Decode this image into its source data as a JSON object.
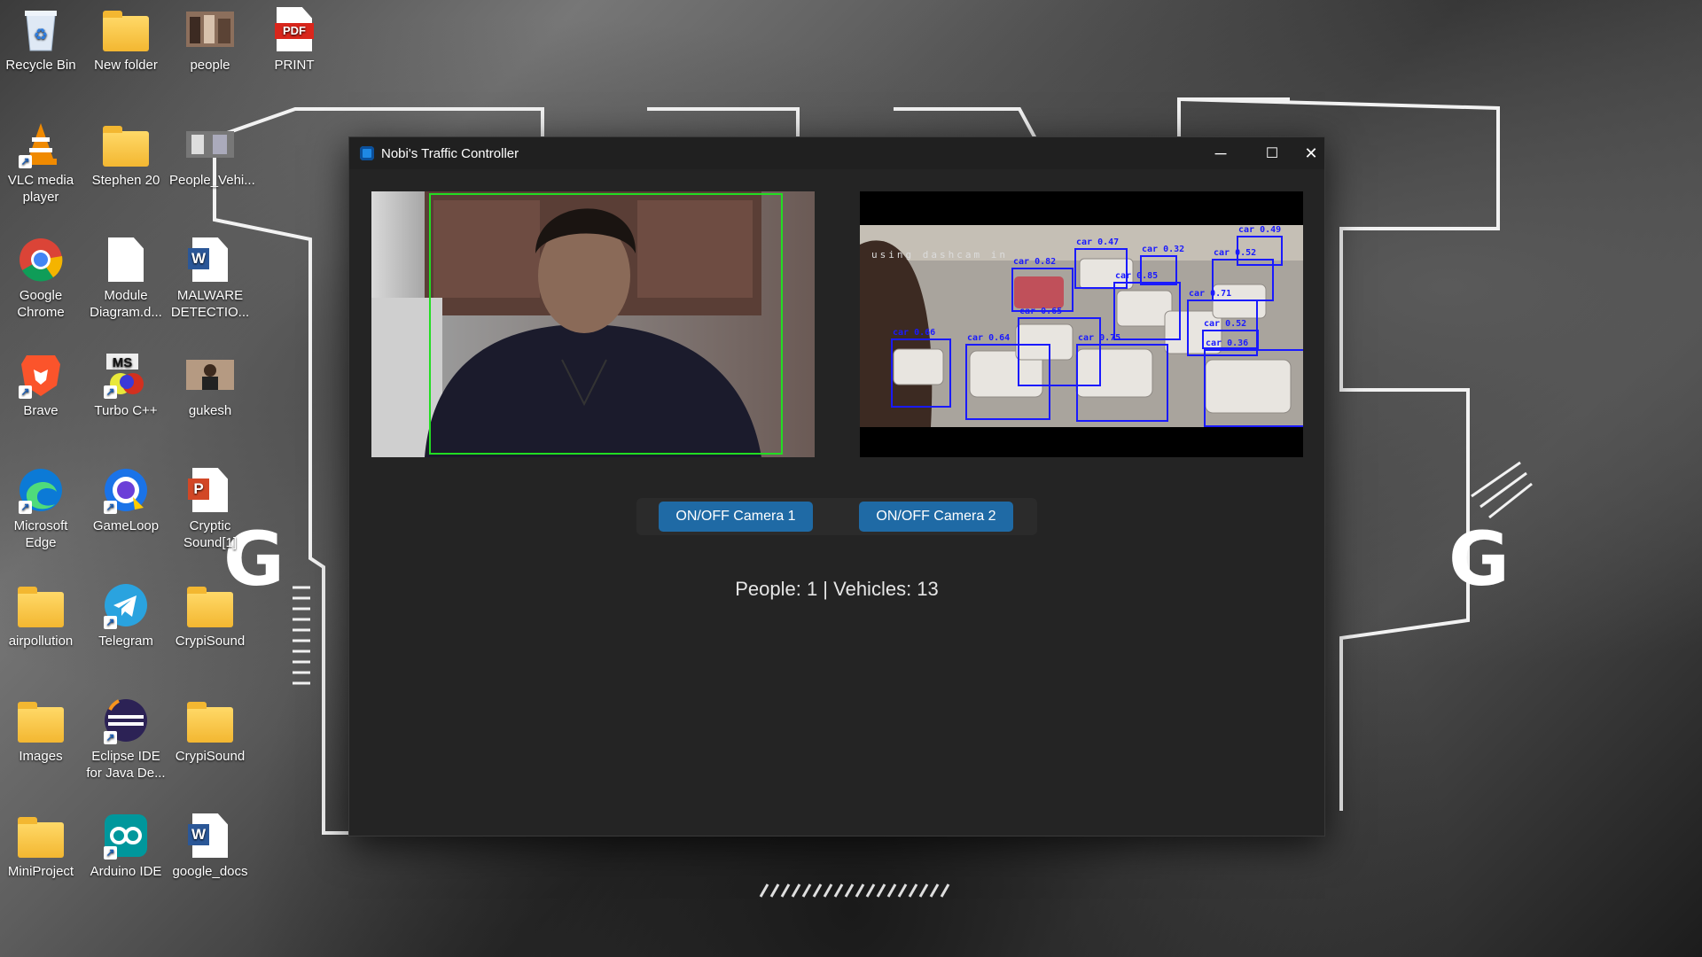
{
  "desktop_icons": [
    {
      "label": "Recycle Bin",
      "icon": "recycle-bin-icon"
    },
    {
      "label": "New folder",
      "icon": "folder-icon"
    },
    {
      "label": "people",
      "icon": "image-icon"
    },
    {
      "label": "PRINT",
      "icon": "pdf-icon",
      "badge": "PDF"
    },
    {
      "label": "VLC media player",
      "icon": "vlc-icon"
    },
    {
      "label": "Stephen 20",
      "icon": "folder-icon"
    },
    {
      "label": "People_Vehi...",
      "icon": "image-icon"
    },
    {
      "label": "Google Chrome",
      "icon": "chrome-icon"
    },
    {
      "label": "Module Diagram.d...",
      "icon": "document-icon"
    },
    {
      "label": "MALWARE DETECTIO...",
      "icon": "word-icon",
      "badge": "W"
    },
    {
      "label": "Brave",
      "icon": "brave-icon"
    },
    {
      "label": "Turbo C++",
      "icon": "turbo-cpp-icon",
      "badge": "MS"
    },
    {
      "label": "gukesh",
      "icon": "image-icon"
    },
    {
      "label": "Microsoft Edge",
      "icon": "edge-icon"
    },
    {
      "label": "GameLoop",
      "icon": "gameloop-icon"
    },
    {
      "label": "Cryptic Sound[1]",
      "icon": "powerpoint-icon",
      "badge": "P"
    },
    {
      "label": "airpollution",
      "icon": "folder-icon"
    },
    {
      "label": "Telegram",
      "icon": "telegram-icon"
    },
    {
      "label": "CrypiSound",
      "icon": "folder-icon"
    },
    {
      "label": "Images",
      "icon": "folder-icon"
    },
    {
      "label": "Eclipse IDE for Java De...",
      "icon": "eclipse-icon"
    },
    {
      "label": "CrypiSound",
      "icon": "folder-icon"
    },
    {
      "label": "MiniProject",
      "icon": "folder-icon"
    },
    {
      "label": "Arduino IDE",
      "icon": "arduino-icon"
    },
    {
      "label": "google_docs",
      "icon": "word-icon",
      "badge": "W"
    }
  ],
  "window": {
    "title": "Nobi's Traffic Controller",
    "controls": {
      "minimize": "─",
      "maximize": "☐",
      "close": "✕"
    },
    "camera1": {
      "detections": [
        {
          "label": ""
        }
      ]
    },
    "camera2": {
      "overlay_text": "using dashcam in",
      "detections": [
        {
          "label": "car 0.47"
        },
        {
          "label": "car 0.32"
        },
        {
          "label": "car 0.49"
        },
        {
          "label": "car 0.82"
        },
        {
          "label": "car 0.85"
        },
        {
          "label": "car 0.52"
        },
        {
          "label": "car 0.71"
        },
        {
          "label": "car 0.65"
        },
        {
          "label": "car 0.66"
        },
        {
          "label": "car 0.64"
        },
        {
          "label": "car 0.75"
        },
        {
          "label": "car 0.36"
        },
        {
          "label": "car 0.52"
        }
      ]
    },
    "buttons": {
      "camera1": "ON/OFF Camera 1",
      "camera2": "ON/OFF Camera 2"
    },
    "stats": "People: 1 | Vehicles: 13"
  },
  "colors": {
    "accent": "#1f6aa5",
    "person_box": "#22dd22",
    "vehicle_box": "#1a1aff"
  }
}
